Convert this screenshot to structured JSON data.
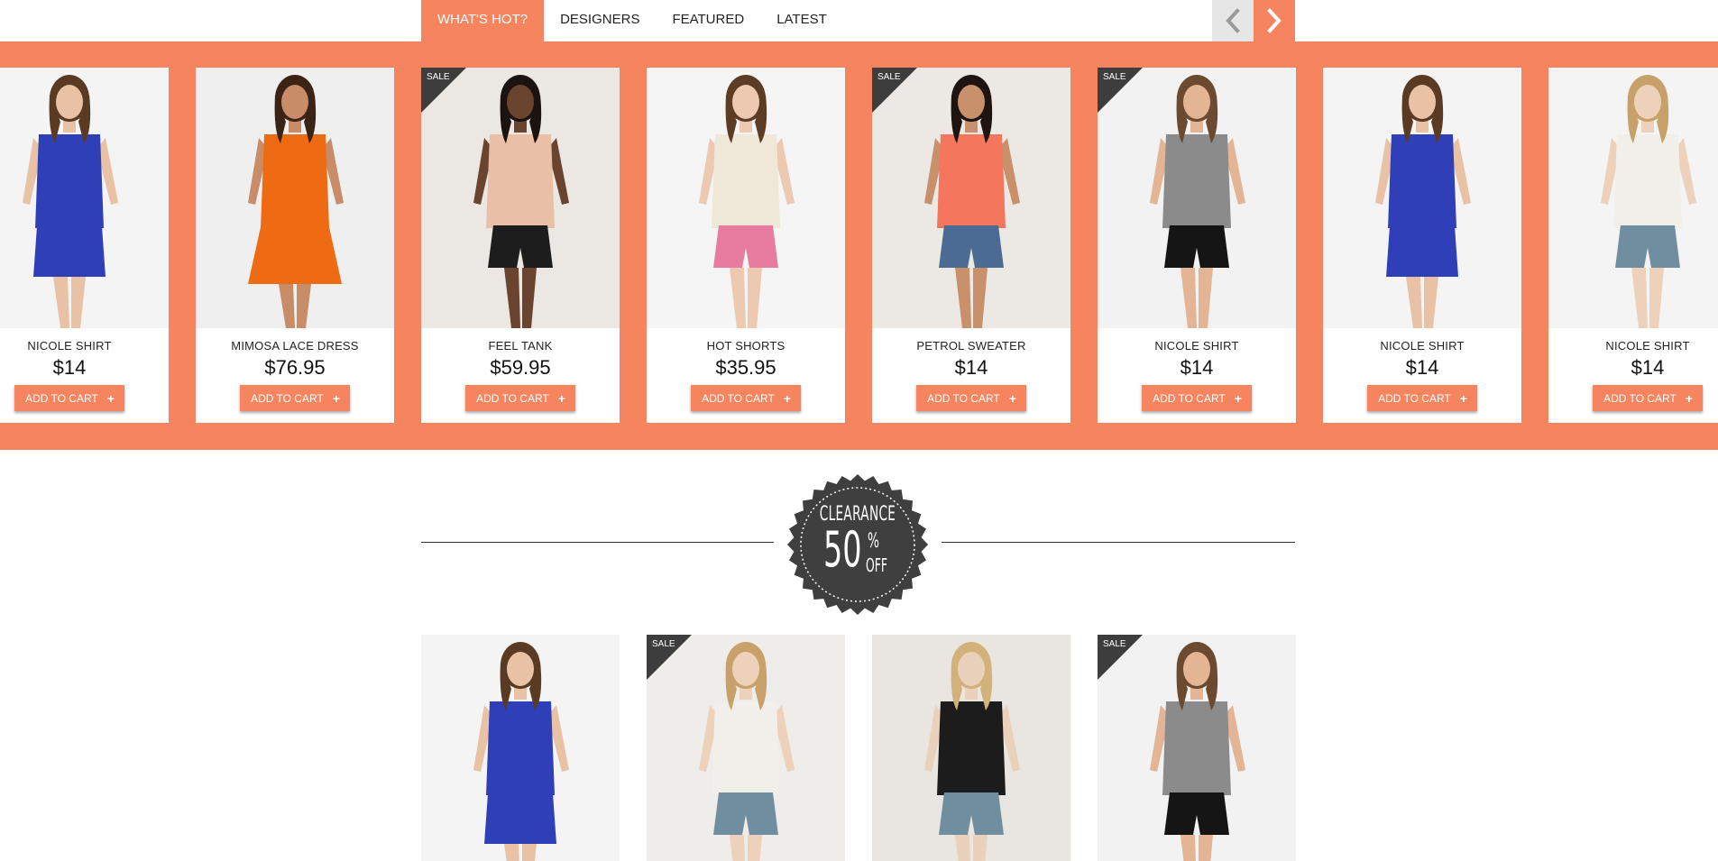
{
  "tabs": [
    {
      "label": "WHAT'S HOT?",
      "active": true
    },
    {
      "label": "DESIGNERS",
      "active": false
    },
    {
      "label": "FEATURED",
      "active": false
    },
    {
      "label": "LATEST",
      "active": false
    }
  ],
  "carousel": {
    "prev_icon": "chevron-left-icon",
    "next_icon": "chevron-right-icon",
    "add_to_cart_label": "ADD TO CART",
    "add_icon": "plus-icon",
    "sale_label": "SALE",
    "products": [
      {
        "name": "NICOLE SHIRT",
        "price": "$14",
        "sale": false,
        "image": "woman in blue draped sleeveless top"
      },
      {
        "name": "MIMOSA LACE DRESS",
        "price": "$76.95",
        "sale": false,
        "image": "woman in orange strapless dress"
      },
      {
        "name": "FEEL TANK",
        "price": "$59.95",
        "sale": true,
        "image": "woman in peach open-back tank, back view"
      },
      {
        "name": "HOT SHORTS",
        "price": "$35.95",
        "sale": false,
        "image": "woman in white lace top and pink shorts"
      },
      {
        "name": "PETROL SWEATER",
        "price": "$14",
        "sale": true,
        "image": "woman in coral top and denim shorts"
      },
      {
        "name": "NICOLE SHIRT",
        "price": "$14",
        "sale": true,
        "image": "woman in sheer printed tank and black shorts"
      },
      {
        "name": "NICOLE SHIRT",
        "price": "$14",
        "sale": false,
        "image": "woman in blue draped sleeveless top"
      },
      {
        "name": "NICOLE SHIRT",
        "price": "$14",
        "sale": false,
        "image": "woman in white blouse and printed shorts"
      }
    ]
  },
  "clearance_badge": {
    "line1": "CLEARANCE",
    "number": "50",
    "percent": "%",
    "off": "OFF"
  },
  "clearance_products": [
    {
      "sale": false,
      "image": "woman in blue draped sleeveless top"
    },
    {
      "sale": true,
      "image": "woman in white blouse with cross necklace"
    },
    {
      "sale": false,
      "image": "woman in black tank and printed shorts"
    },
    {
      "sale": true,
      "image": "woman in sheer printed tank and black shorts"
    }
  ],
  "colors": {
    "accent": "#f5845f",
    "dark": "#3d3d3d",
    "badge": "#3f3f3f"
  }
}
